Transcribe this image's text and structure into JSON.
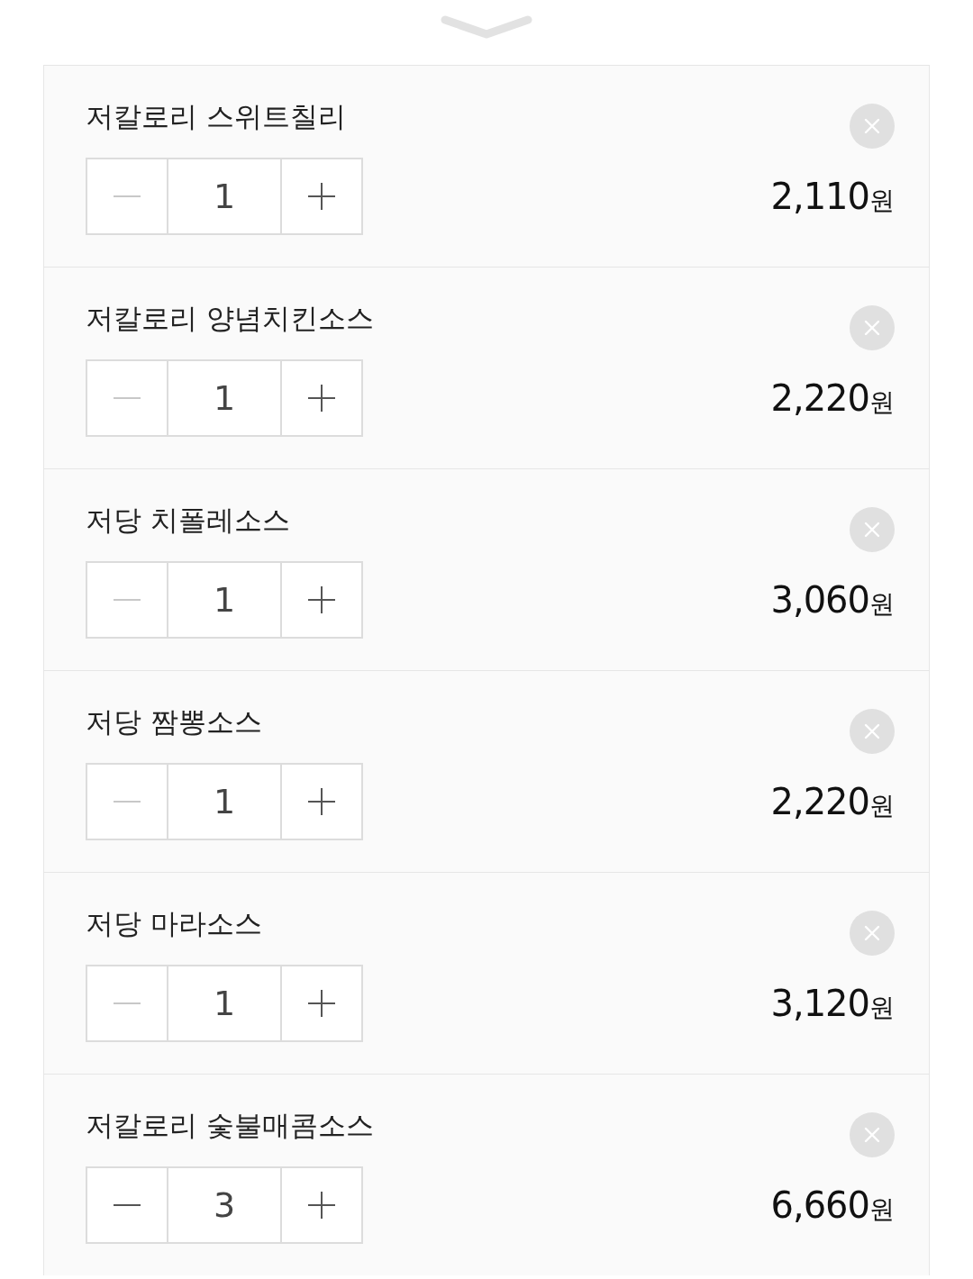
{
  "items": [
    {
      "name": "저칼로리 스위트칠리",
      "quantity": "1",
      "minus_disabled": true,
      "price": "2,110",
      "currency": "원"
    },
    {
      "name": "저칼로리 양념치킨소스",
      "quantity": "1",
      "minus_disabled": true,
      "price": "2,220",
      "currency": "원"
    },
    {
      "name": "저당 치폴레소스",
      "quantity": "1",
      "minus_disabled": true,
      "price": "3,060",
      "currency": "원"
    },
    {
      "name": "저당 짬뽕소스",
      "quantity": "1",
      "minus_disabled": true,
      "price": "2,220",
      "currency": "원"
    },
    {
      "name": "저당 마라소스",
      "quantity": "1",
      "minus_disabled": true,
      "price": "3,120",
      "currency": "원"
    },
    {
      "name": "저칼로리 숯불매콤소스",
      "quantity": "3",
      "minus_disabled": false,
      "price": "6,660",
      "currency": "원"
    }
  ]
}
